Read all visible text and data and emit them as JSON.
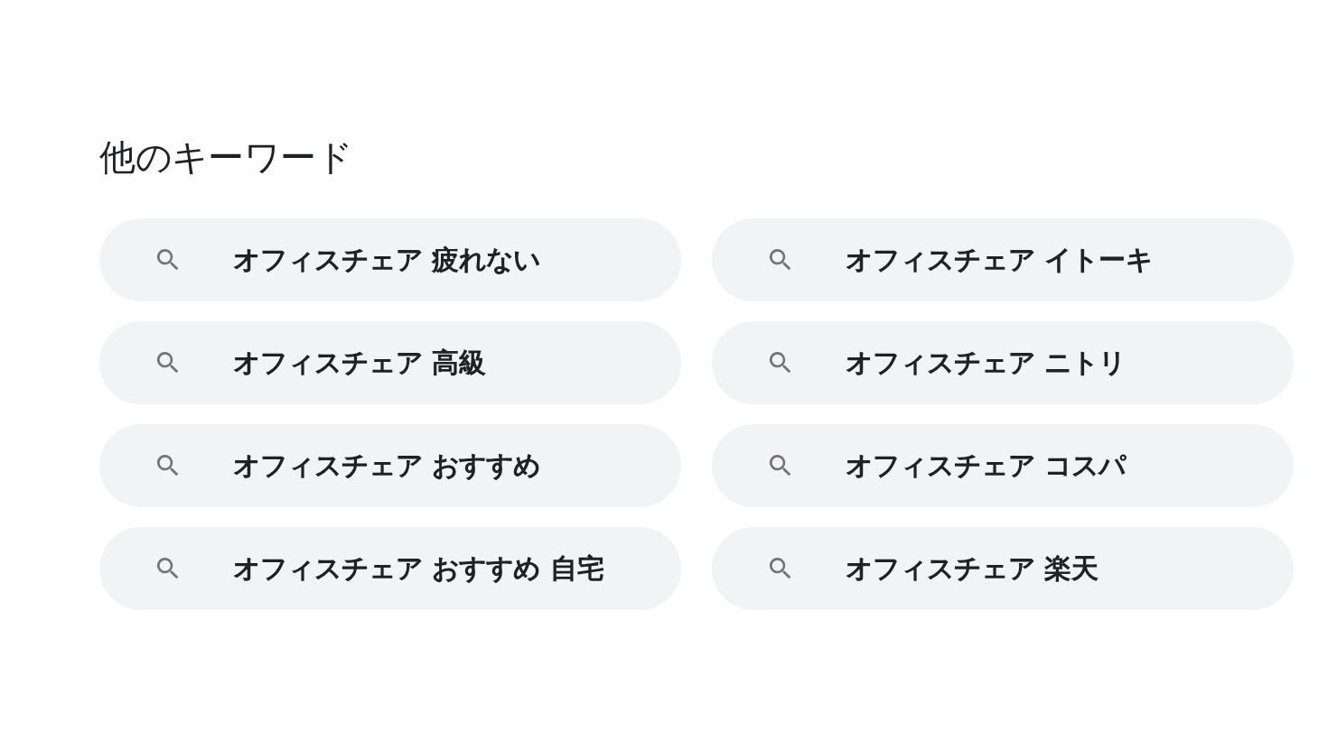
{
  "heading": "他のキーワード",
  "suggestions": [
    {
      "text": "オフィスチェア 疲れない"
    },
    {
      "text": "オフィスチェア イトーキ"
    },
    {
      "text": "オフィスチェア 高級"
    },
    {
      "text": "オフィスチェア ニトリ"
    },
    {
      "text": "オフィスチェア おすすめ"
    },
    {
      "text": "オフィスチェア コスパ"
    },
    {
      "text": "オフィスチェア おすすめ 自宅"
    },
    {
      "text": "オフィスチェア 楽天"
    }
  ]
}
